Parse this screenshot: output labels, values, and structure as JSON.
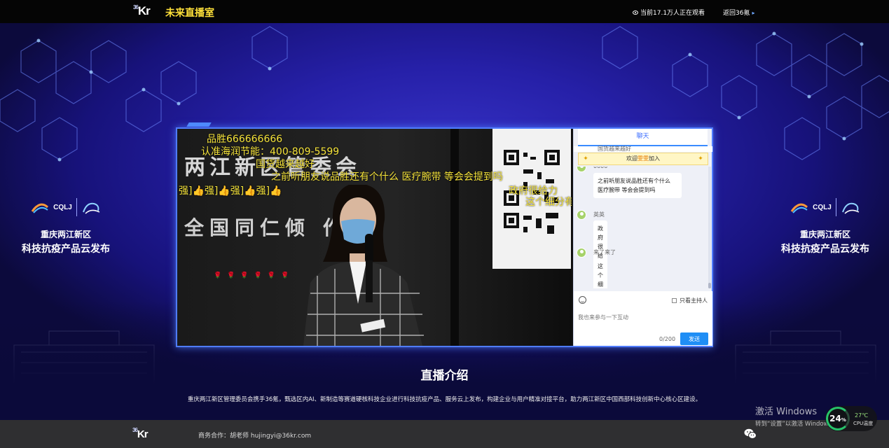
{
  "header": {
    "logo_sup": "36",
    "logo_text": "Kr",
    "title": "未来直播室",
    "viewers": "当前17.1万人正在观看",
    "back_link": "返回36氪"
  },
  "side_banner": {
    "logo_mark": "CQLJ",
    "line1": "重庆两江新区",
    "line2": "科技抗疫产品云发布"
  },
  "video": {
    "backdrop_line1": "两江新区管委会",
    "backdrop_line2": "全国同仁倾 作",
    "flowers": "🌹🌹🌹🌹🌹🌹",
    "danmaku": [
      "品胜666666666",
      "认准海润节能：400-809-5599",
      "国货越来越好",
      "之前听朋友说品胜还有个什么 医疗腕带 等会会提到吗",
      "强]👍强]👍强]👍强]👍",
      "政府很给力",
      "这个细分有"
    ]
  },
  "chat": {
    "tab_label": "聊天",
    "top_strip_text": "国货越来越好",
    "welcome_prefix": "欢迎",
    "welcome_name": "雯雯",
    "welcome_suffix": "加入",
    "messages": [
      {
        "user": "0000",
        "text": "之前听朋友说品胜还有个什么 医疗腕带 等会会提到吗"
      },
      {
        "user": "英英",
        "text": "政府很给力"
      },
      {
        "user": "来了来了",
        "text": "这个细分有前景"
      }
    ],
    "host_only_label": "只看主持人",
    "input_placeholder": "我也来参与一下互动",
    "char_count": "0/200",
    "send_label": "发送",
    "colors": {
      "accent": "#1f8ef5",
      "welcome_bg": "#fff6c5"
    }
  },
  "intro": {
    "title": "直播介绍",
    "description": "重庆两江新区管理委员会携手36氪，甄选区内AI、新制造等赛道硬核科技企业进行科技抗疫产品、服务云上发布，构建企业与用户精准对接平台，助力两江新区中国西部科技创新中心核心区建设。"
  },
  "footer": {
    "logo_sup": "36",
    "logo_text": "Kr",
    "contact": "商务合作：胡老师 hujingyi@36kr.com"
  },
  "windows_overlay": {
    "activate_title": "激活 Windows",
    "activate_sub": "转到“设置”以激活 Windows。"
  },
  "cpu_widget": {
    "percent": "24",
    "percent_unit": "%",
    "temp": "27℃",
    "label": "CPU温度"
  }
}
